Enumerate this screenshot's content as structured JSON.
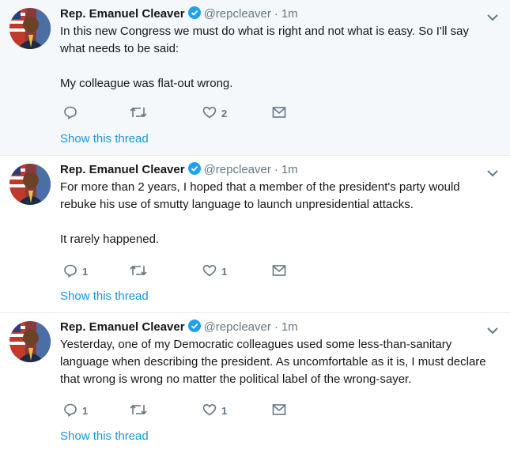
{
  "tweets": [
    {
      "name": "Rep. Emanuel Cleaver",
      "handle": "@repcleaver",
      "dot": "·",
      "time": "1m",
      "lines": [
        "In this new Congress we must do what is right and not what is easy. So I'll say",
        "what needs to be said:",
        "",
        "My colleague was flat-out wrong."
      ],
      "reply_count": "",
      "retweet_count": "",
      "like_count": "2",
      "thread_link": "Show this thread"
    },
    {
      "name": "Rep. Emanuel Cleaver",
      "handle": "@repcleaver",
      "dot": "·",
      "time": "1m",
      "lines": [
        "For more than 2 years, I hoped that a member of the president's party would",
        "rebuke his use of smutty language to launch unpresidential attacks.",
        "",
        "It rarely happened."
      ],
      "reply_count": "1",
      "retweet_count": "",
      "like_count": "1",
      "thread_link": "Show this thread"
    },
    {
      "name": "Rep. Emanuel Cleaver",
      "handle": "@repcleaver",
      "dot": "·",
      "time": "1m",
      "lines": [
        "Yesterday, one of my Democratic colleagues used some less-than-sanitary",
        "language when describing the president. As uncomfortable as it is, I must declare",
        "that wrong is wrong no matter the political label of the wrong-sayer."
      ],
      "reply_count": "1",
      "retweet_count": "",
      "like_count": "1",
      "thread_link": "Show this thread"
    }
  ],
  "icons": {
    "reply": "reply-icon",
    "retweet": "retweet-icon",
    "like": "like-icon",
    "message": "direct-message-icon",
    "verified": "verified-badge-icon",
    "caret": "chevron-down-icon"
  },
  "colors": {
    "highlight_bg": "#f5f8fa",
    "link": "#1b95e0",
    "muted": "#657786",
    "verified": "#1da1f2"
  }
}
